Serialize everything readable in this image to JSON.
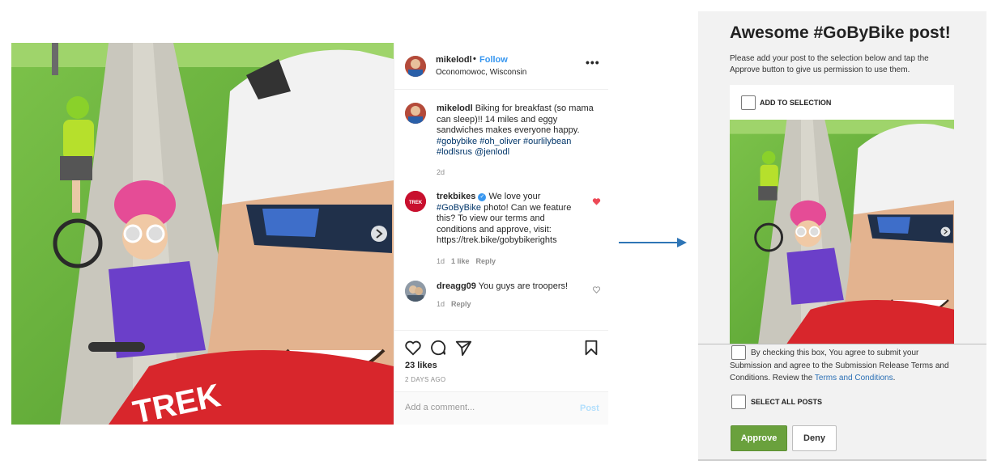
{
  "post": {
    "username": "mikelodl",
    "dot": "•",
    "follow_label": "Follow",
    "location": "Oconomowoc, Wisconsin",
    "more_icon": "more-horizontal-icon",
    "caption": {
      "user": "mikelodl",
      "text": "Biking for breakfast (so mama can sleep)!! 14 miles and eggy sandwiches makes everyone happy.",
      "tags": "#gobybike #oh_oliver #ourlilybean #lodlsrus @jenlodl",
      "time": "2d"
    },
    "comments": [
      {
        "user": "trekbikes",
        "text_before": "We love your",
        "tag": "#GoByBike",
        "text_after": "photo! Can we feature this? To view our terms and conditions and approve, visit: https://trek.bike/gobybikerights",
        "time": "1d",
        "likes": "1 like",
        "reply": "Reply",
        "liked": true
      },
      {
        "user": "dreagg09",
        "text": "You guys are troopers!",
        "time": "1d",
        "reply": "Reply",
        "liked": false
      }
    ],
    "likes": "23 likes",
    "posted": "2 DAYS AGO",
    "comment_placeholder": "Add a comment...",
    "post_label": "Post",
    "photo_shirt_text": "TREK"
  },
  "approval": {
    "title": "Awesome #GoByBike post!",
    "description": "Please add your post to the selection below and tap the Approve button to give us permission to use them.",
    "add_to_selection": "ADD TO SELECTION",
    "agree_text": "By checking this box, You agree to submit your Submission and agree to the Submission Release Terms and Conditions. Review the",
    "terms_link": "Terms and Conditions",
    "terms_end": ".",
    "select_all": "SELECT ALL POSTS",
    "approve_label": "Approve",
    "deny_label": "Deny"
  },
  "colors": {
    "follow": "#3897f0",
    "approve": "#6aa13d",
    "link": "#2a6fb5",
    "heart": "#ed4956",
    "arrow": "#2e75b6"
  }
}
